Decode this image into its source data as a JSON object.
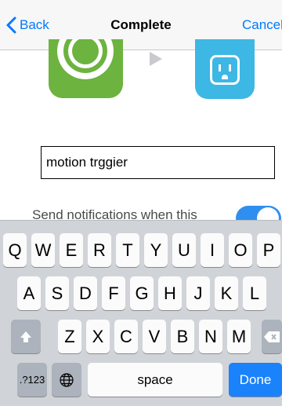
{
  "nav": {
    "back_label": "Back",
    "title": "Complete",
    "cancel_label": "Cancel"
  },
  "recipe": {
    "trigger_icon": "motion-sensor-ring-icon",
    "trigger_color": "#6cb33f",
    "action_icon": "power-outlet-icon",
    "action_color": "#3db7e4"
  },
  "name_field": {
    "value": "motion trggier"
  },
  "notifications": {
    "label": "Send notifications when this",
    "enabled": true,
    "toggle_color": "#2f8ff0"
  },
  "keyboard": {
    "row1": [
      "Q",
      "W",
      "E",
      "R",
      "T",
      "Y",
      "U",
      "I",
      "O",
      "P"
    ],
    "row2": [
      "A",
      "S",
      "D",
      "F",
      "G",
      "H",
      "J",
      "K",
      "L"
    ],
    "row3": [
      "Z",
      "X",
      "C",
      "V",
      "B",
      "N",
      "M"
    ],
    "numbers_label": ".?123",
    "space_label": "space",
    "done_label": "Done",
    "done_color": "#1a82fb"
  }
}
